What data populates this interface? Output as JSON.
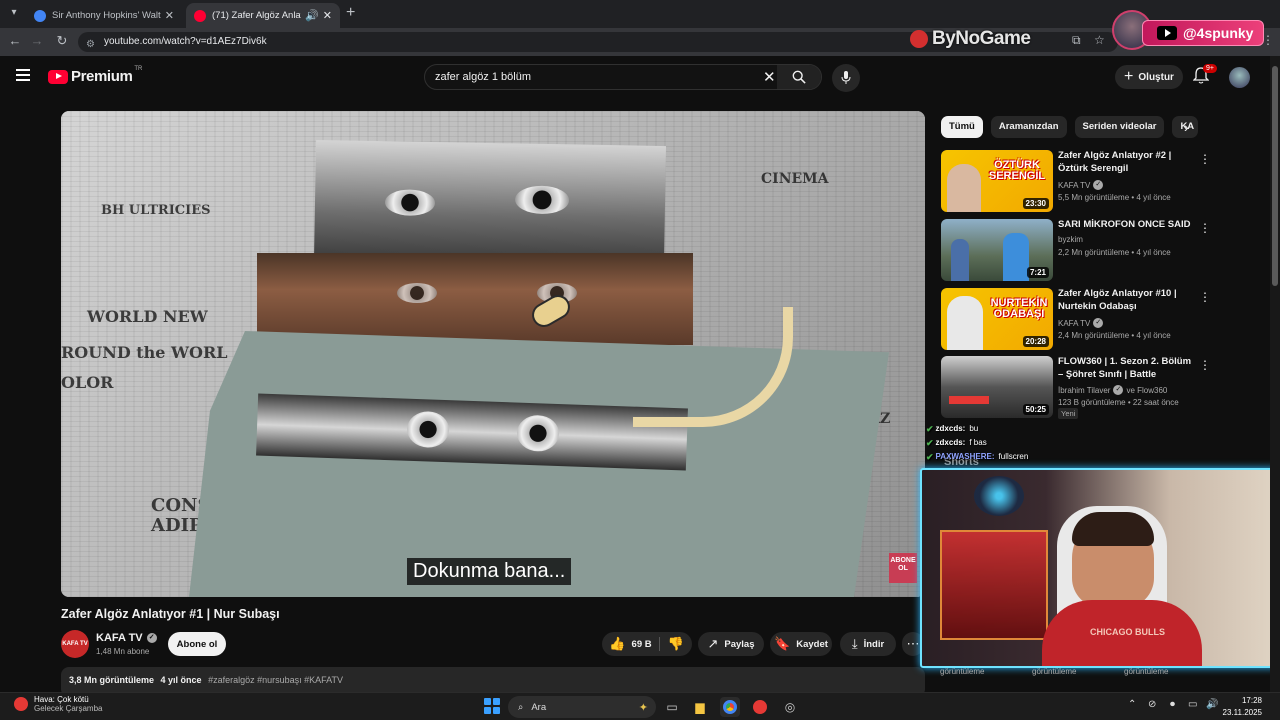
{
  "browser": {
    "tabs": [
      {
        "title": "Sir Anthony Hopkins' Waltz - G",
        "active": false
      },
      {
        "title": "(71) Zafer Algöz Anlatıyor #",
        "active": true
      }
    ],
    "url": "youtube.com/watch?v=d1AEz7Div6k"
  },
  "overlay": {
    "sponsor": "ByNoGame",
    "handle": "@4spunky"
  },
  "masthead": {
    "brand": "Premium",
    "region": "TR",
    "search_value": "zafer algöz 1 bölüm",
    "create_label": "Oluştur",
    "notif_count": "9+"
  },
  "video": {
    "caption": "Dokunma bana...",
    "abone_tag": "ABONE OL",
    "title": "Zafer Algöz Anlatıyor #1 | Nur Subaşı",
    "channel": "KAFA TV",
    "channel_logo": "KAFA TV",
    "subscribers": "1,48 Mn abone",
    "subscribe_label": "Abone ol",
    "likes": "69 B",
    "share_label": "Paylaş",
    "save_label": "Kaydet",
    "download_label": "İndir",
    "views": "3,8 Mn görüntüleme",
    "age": "4 yıl önce",
    "tags": "#zaferalgöz #nursubaşı #KAFATV"
  },
  "chips": [
    "Tümü",
    "Aramanızdan",
    "Seriden videolar",
    "KA"
  ],
  "related": [
    {
      "title": "Zafer Algöz Anlatıyor #2 | Öztürk Serengil",
      "channel": "KAFA TV",
      "verified": true,
      "meta": "5,5 Mn görüntüleme • 4 yıl önce",
      "duration": "23:30",
      "thumb_text": "ÖZTÜRK SERENGİL"
    },
    {
      "title": "SARI MİKROFON ONCE SAID",
      "channel": "byzkim",
      "verified": false,
      "meta": "2,2 Mn görüntüleme • 4 yıl önce",
      "duration": "7:21",
      "thumb_text": ""
    },
    {
      "title": "Zafer Algöz Anlatıyor #10 | Nurtekin Odabaşı",
      "channel": "KAFA TV",
      "verified": true,
      "meta": "2,4 Mn görüntüleme • 4 yıl önce",
      "duration": "20:28",
      "thumb_text": "NURTEKİN ODABAŞI"
    },
    {
      "title": "FLOW360 | 1. Sezon 2. Bölüm – Şöhret Sınıfı | Battle",
      "channel": "İbrahim Tilaver",
      "channel_extra": "ve Flow360",
      "verified": true,
      "meta": "123 B görüntüleme • 22 saat önce",
      "duration": "50:25",
      "thumb_text": "",
      "badge": "Yeni"
    }
  ],
  "chat": [
    {
      "user": "zdxcds:",
      "msg": "bu"
    },
    {
      "user": "zdxcds:",
      "msg": "f bas"
    },
    {
      "user": "PAXWASHERE:",
      "msg": "fullscren"
    }
  ],
  "shorts_label": "Shorts",
  "webcam": {
    "shirt_text": "CHICAGO BULLS"
  },
  "under_cam": [
    "görüntüleme",
    "görüntüleme",
    "görüntüleme"
  ],
  "taskbar": {
    "weather_line1": "Hava: Çok kötü",
    "weather_line2": "Gelecek Çarşamba",
    "search_placeholder": "Ara",
    "time": "17:28",
    "date": "23.11.2025"
  },
  "colors": {
    "accent_red": "#ff0033",
    "webcam_border": "#6fe3ff",
    "badge_pink": "#c2185b"
  }
}
